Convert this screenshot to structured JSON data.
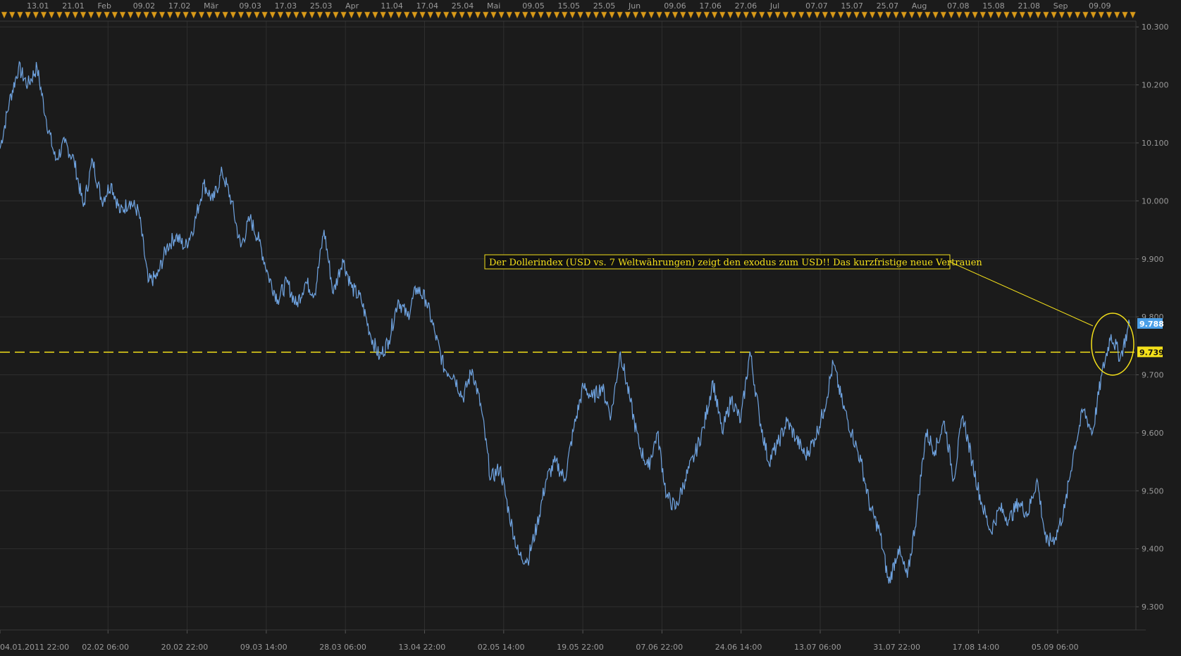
{
  "chart_data": {
    "type": "line",
    "title": "",
    "xlabel": "",
    "ylabel": "",
    "ylim": [
      9.26,
      10.31
    ],
    "grid": true,
    "y_ticks": [
      "10.300",
      "10.200",
      "10.100",
      "10.000",
      "9.900",
      "9.800",
      "9.700",
      "9.600",
      "9.500",
      "9.400",
      "9.300"
    ],
    "top_ticks": [
      "13.01",
      "21.01",
      "Feb",
      "09.02",
      "17.02",
      "Mär",
      "09.03",
      "17.03",
      "25.03",
      "Apr",
      "11.04",
      "17.04",
      "25.04",
      "Mai",
      "09.05",
      "15.05",
      "25.05",
      "Jun",
      "09.06",
      "17.06",
      "27.06",
      "Jul",
      "07.07",
      "15.07",
      "25.07",
      "Aug",
      "07.08",
      "15.08",
      "21.08",
      "Sep",
      "09.09"
    ],
    "bottom_ticks": [
      "04.01.2011 22:00",
      "02.02 06:00",
      "20.02 22:00",
      "09.03 14:00",
      "28.03 06:00",
      "13.04 22:00",
      "02.05 14:00",
      "19.05 22:00",
      "07.06 22:00",
      "24.06 14:00",
      "13.07 06:00",
      "31.07 22:00",
      "17.08 14:00",
      "05.09 06:00"
    ],
    "series": [
      {
        "color": "#6fa3e0",
        "values": [
          10.09,
          10.17,
          10.23,
          10.2,
          10.23,
          10.14,
          10.07,
          10.1,
          10.07,
          9.99,
          10.07,
          10.0,
          10.03,
          9.98,
          10.0,
          9.98,
          9.86,
          9.87,
          9.92,
          9.94,
          9.92,
          9.96,
          10.03,
          10.0,
          10.05,
          10.0,
          9.92,
          9.97,
          9.93,
          9.87,
          9.83,
          9.86,
          9.82,
          9.86,
          9.84,
          9.95,
          9.84,
          9.9,
          9.85,
          9.83,
          9.77,
          9.73,
          9.76,
          9.83,
          9.8,
          9.85,
          9.83,
          9.77,
          9.71,
          9.7,
          9.66,
          9.71,
          9.64,
          9.52,
          9.54,
          9.46,
          9.39,
          9.38,
          9.44,
          9.52,
          9.55,
          9.52,
          9.61,
          9.68,
          9.66,
          9.68,
          9.63,
          9.74,
          9.66,
          9.58,
          9.54,
          9.6,
          9.49,
          9.47,
          9.52,
          9.56,
          9.61,
          9.69,
          9.6,
          9.66,
          9.62,
          9.74,
          9.63,
          9.55,
          9.58,
          9.62,
          9.59,
          9.56,
          9.59,
          9.64,
          9.72,
          9.65,
          9.6,
          9.55,
          9.47,
          9.43,
          9.34,
          9.4,
          9.35,
          9.46,
          9.6,
          9.57,
          9.62,
          9.52,
          9.63,
          9.55,
          9.48,
          9.43,
          9.47,
          9.45,
          9.48,
          9.46,
          9.52,
          9.41,
          9.42,
          9.47,
          9.57,
          9.64,
          9.6,
          9.7,
          9.77,
          9.73,
          9.788
        ]
      }
    ],
    "reference_line": {
      "value": 9.739,
      "label": "9.739",
      "color": "#f4e01a",
      "style": "dashed"
    },
    "last_value_tag": {
      "value": 9.788,
      "label": "9.788",
      "color": "#4a9fe8"
    },
    "annotation": {
      "text": "Der Dollerindex (USD vs. 7 Weltwährungen) zeigt den exodus zum USD!! Das kurzfristige neue Vertrauen",
      "color": "#f4e01a"
    }
  },
  "colors": {
    "background": "#1b1b1b",
    "grid": "#2f2f2f",
    "axis_text": "#9a9a9a",
    "marker": "#d99a1a"
  }
}
